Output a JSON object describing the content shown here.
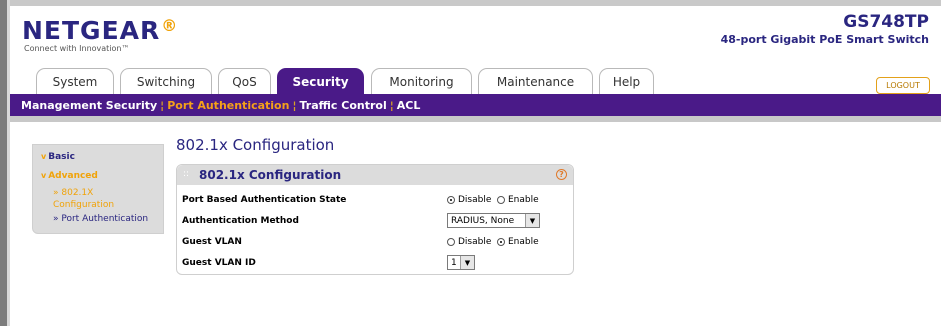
{
  "brand": {
    "logo": "NETGEAR",
    "tagline": "Connect with Innovation™",
    "model": "GS748TP",
    "model_desc": "48-port Gigabit PoE Smart Switch"
  },
  "tabs": [
    {
      "label": "System"
    },
    {
      "label": "Switching"
    },
    {
      "label": "QoS"
    },
    {
      "label": "Security"
    },
    {
      "label": "Monitoring"
    },
    {
      "label": "Maintenance"
    },
    {
      "label": "Help"
    }
  ],
  "logout_label": "LOGOUT",
  "subnav": [
    {
      "label": "Management Security"
    },
    {
      "label": "Port Authentication"
    },
    {
      "label": "Traffic Control"
    },
    {
      "label": "ACL"
    }
  ],
  "sidebar": {
    "basic": "Basic",
    "advanced": "Advanced",
    "config_line1": "» 802.1X",
    "config_line2": "Configuration",
    "port_auth": "» Port Authentication"
  },
  "page_title": "802.1x Configuration",
  "panel": {
    "title": "802.1x Configuration",
    "rows": [
      {
        "label": "Port Based Authentication State",
        "opt1": "Disable",
        "opt2": "Enable"
      },
      {
        "label": "Authentication Method",
        "value": "RADIUS, None"
      },
      {
        "label": "Guest VLAN",
        "opt1": "Disable",
        "opt2": "Enable"
      },
      {
        "label": "Guest VLAN ID",
        "value": "1"
      }
    ]
  }
}
